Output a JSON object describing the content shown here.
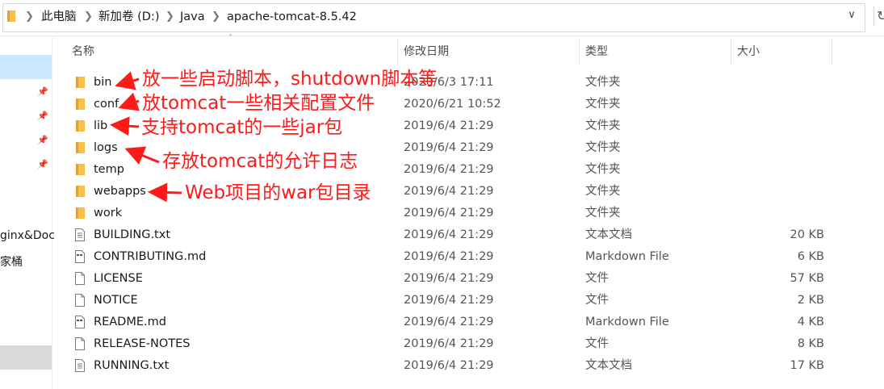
{
  "address_bar": {
    "crumbs": [
      "此电脑",
      "新加卷 (D:)",
      "Java",
      "apache-tomcat-8.5.42"
    ]
  },
  "nav_pane": {
    "items": [
      "ginx&Doc",
      "家桶"
    ]
  },
  "columns": {
    "name": "名称",
    "date": "修改日期",
    "type": "类型",
    "size": "大小"
  },
  "files": [
    {
      "name": "bin",
      "date": "2020/6/3 17:11",
      "type": "文件夹",
      "size": "",
      "icon": "folder-icon"
    },
    {
      "name": "conf",
      "date": "2020/6/21 10:52",
      "type": "文件夹",
      "size": "",
      "icon": "folder-icon"
    },
    {
      "name": "lib",
      "date": "2019/6/4 21:29",
      "type": "文件夹",
      "size": "",
      "icon": "folder-icon"
    },
    {
      "name": "logs",
      "date": "2019/6/4 21:29",
      "type": "文件夹",
      "size": "",
      "icon": "folder-icon"
    },
    {
      "name": "temp",
      "date": "2019/6/4 21:29",
      "type": "文件夹",
      "size": "",
      "icon": "folder-icon"
    },
    {
      "name": "webapps",
      "date": "2019/6/4 21:29",
      "type": "文件夹",
      "size": "",
      "icon": "folder-icon"
    },
    {
      "name": "work",
      "date": "2019/6/4 21:29",
      "type": "文件夹",
      "size": "",
      "icon": "folder-icon"
    },
    {
      "name": "BUILDING.txt",
      "date": "2019/6/4 21:29",
      "type": "文本文档",
      "size": "20 KB",
      "icon": "text-file-icon"
    },
    {
      "name": "CONTRIBUTING.md",
      "date": "2019/6/4 21:29",
      "type": "Markdown File",
      "size": "6 KB",
      "icon": "markdown-file-icon"
    },
    {
      "name": "LICENSE",
      "date": "2019/6/4 21:29",
      "type": "文件",
      "size": "57 KB",
      "icon": "file-icon"
    },
    {
      "name": "NOTICE",
      "date": "2019/6/4 21:29",
      "type": "文件",
      "size": "2 KB",
      "icon": "file-icon"
    },
    {
      "name": "README.md",
      "date": "2019/6/4 21:29",
      "type": "Markdown File",
      "size": "4 KB",
      "icon": "markdown-file-icon"
    },
    {
      "name": "RELEASE-NOTES",
      "date": "2019/6/4 21:29",
      "type": "文件",
      "size": "8 KB",
      "icon": "file-icon"
    },
    {
      "name": "RUNNING.txt",
      "date": "2019/6/4 21:29",
      "type": "文本文档",
      "size": "17 KB",
      "icon": "text-file-icon"
    }
  ],
  "annotations": {
    "bin": "放一些启动脚本，shutdown脚本等",
    "conf": "放tomcat一些相关配置文件",
    "lib": "支持tomcat的一些jar包",
    "logs": "存放tomcat的允许日志",
    "webapps": "Web项目的war包目录"
  },
  "colors": {
    "annotation": "#ff1a1a",
    "folder": "#f8c04a",
    "selection": "#cce8ff"
  }
}
